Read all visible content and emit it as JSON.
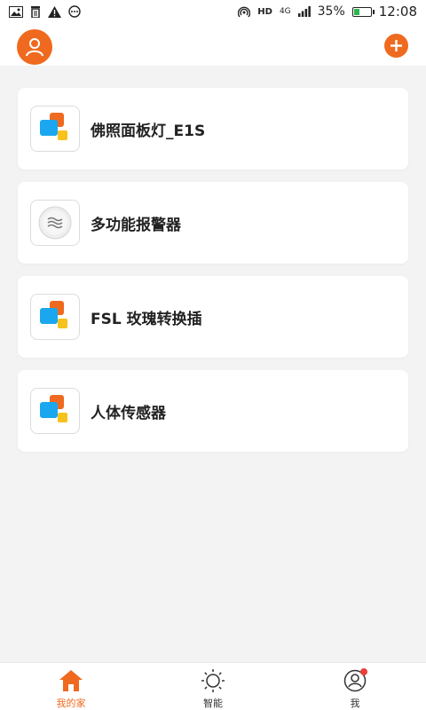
{
  "status_bar": {
    "battery_percent": "35%",
    "battery_level": 0.35,
    "network": "4G",
    "hd": "HD",
    "time": "12:08"
  },
  "header": {
    "avatar_icon": "user-icon",
    "add_icon": "plus-icon"
  },
  "devices": [
    {
      "name": "佛照面板灯_E1S",
      "icon": "app-tiles-icon"
    },
    {
      "name": "多功能报警器",
      "icon": "alarm-waves-icon"
    },
    {
      "name": "FSL 玫瑰转换插",
      "icon": "app-tiles-icon"
    },
    {
      "name": "人体传感器",
      "icon": "app-tiles-icon"
    }
  ],
  "tabs": [
    {
      "label": "我的家",
      "icon": "home-icon",
      "active": true
    },
    {
      "label": "智能",
      "icon": "sun-icon",
      "active": false
    },
    {
      "label": "我",
      "icon": "profile-icon",
      "active": false,
      "badge": true
    }
  ],
  "colors": {
    "accent": "#ef6a1f",
    "background": "#f3f3f3",
    "tile_blue": "#1aa7f0",
    "tile_orange": "#ef6a1f",
    "tile_yellow": "#f7c21b",
    "badge_red": "#e8403a"
  }
}
